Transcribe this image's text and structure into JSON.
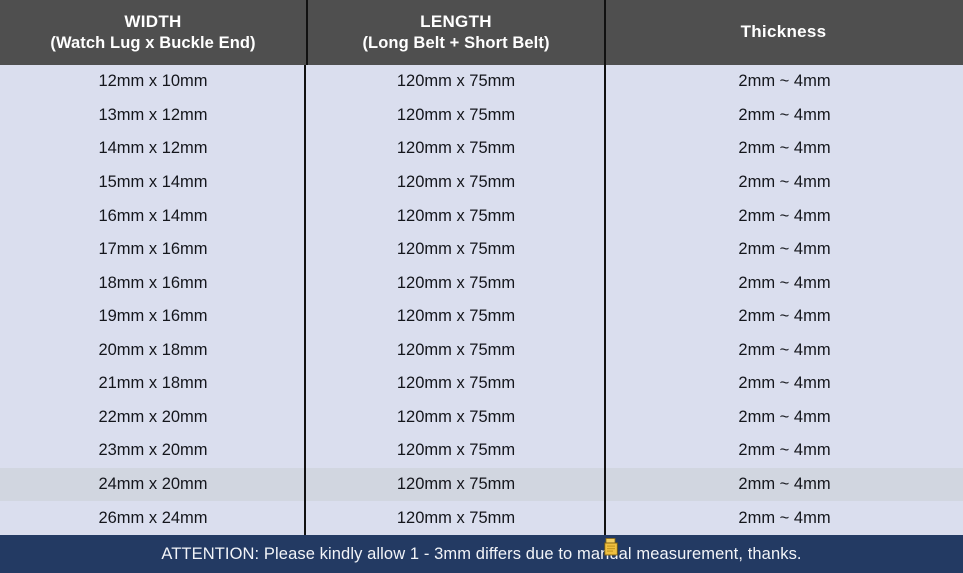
{
  "table": {
    "headers": [
      {
        "line1": "WIDTH",
        "line2": "(Watch Lug x Buckle End)"
      },
      {
        "line1": "LENGTH",
        "line2": "(Long Belt + Short Belt)"
      },
      {
        "line1": "Thickness",
        "line2": ""
      }
    ],
    "rows": [
      {
        "width": "12mm x 10mm",
        "length": "120mm x 75mm",
        "thickness": "2mm ~ 4mm"
      },
      {
        "width": "13mm x 12mm",
        "length": "120mm x 75mm",
        "thickness": "2mm ~ 4mm"
      },
      {
        "width": "14mm x 12mm",
        "length": "120mm x 75mm",
        "thickness": "2mm ~ 4mm"
      },
      {
        "width": "15mm x 14mm",
        "length": "120mm x 75mm",
        "thickness": "2mm ~ 4mm"
      },
      {
        "width": "16mm x 14mm",
        "length": "120mm x 75mm",
        "thickness": "2mm ~ 4mm"
      },
      {
        "width": "17mm x 16mm",
        "length": "120mm x 75mm",
        "thickness": "2mm ~ 4mm"
      },
      {
        "width": "18mm x 16mm",
        "length": "120mm x 75mm",
        "thickness": "2mm ~ 4mm"
      },
      {
        "width": "19mm x 16mm",
        "length": "120mm x 75mm",
        "thickness": "2mm ~ 4mm"
      },
      {
        "width": "20mm x 18mm",
        "length": "120mm x 75mm",
        "thickness": "2mm ~ 4mm"
      },
      {
        "width": "21mm x 18mm",
        "length": "120mm x 75mm",
        "thickness": "2mm ~ 4mm"
      },
      {
        "width": "22mm x 20mm",
        "length": "120mm x 75mm",
        "thickness": "2mm ~ 4mm"
      },
      {
        "width": "23mm x 20mm",
        "length": "120mm x 75mm",
        "thickness": "2mm ~ 4mm"
      },
      {
        "width": "24mm x 20mm",
        "length": "120mm x 75mm",
        "thickness": "2mm ~ 4mm"
      },
      {
        "width": "26mm x 24mm",
        "length": "120mm x 75mm",
        "thickness": "2mm ~ 4mm"
      }
    ],
    "highlighted_row_index": 12
  },
  "footer": {
    "attention_text": "ATTENTION: Please kindly allow 1 - 3mm differs due to manual measurement, thanks."
  },
  "icons": {
    "cursor_artifact": "drag-copy-cursor-icon"
  },
  "colors": {
    "header_background": "#4f4f4f",
    "header_text": "#ffffff",
    "body_background": "#dadeee",
    "body_alt_row": "#d1d6e0",
    "body_text": "#14161c",
    "divider": "#111111",
    "footer_background": "#233a63",
    "footer_text": "#f2f4f8",
    "cursor_artifact": "#f0c040"
  }
}
